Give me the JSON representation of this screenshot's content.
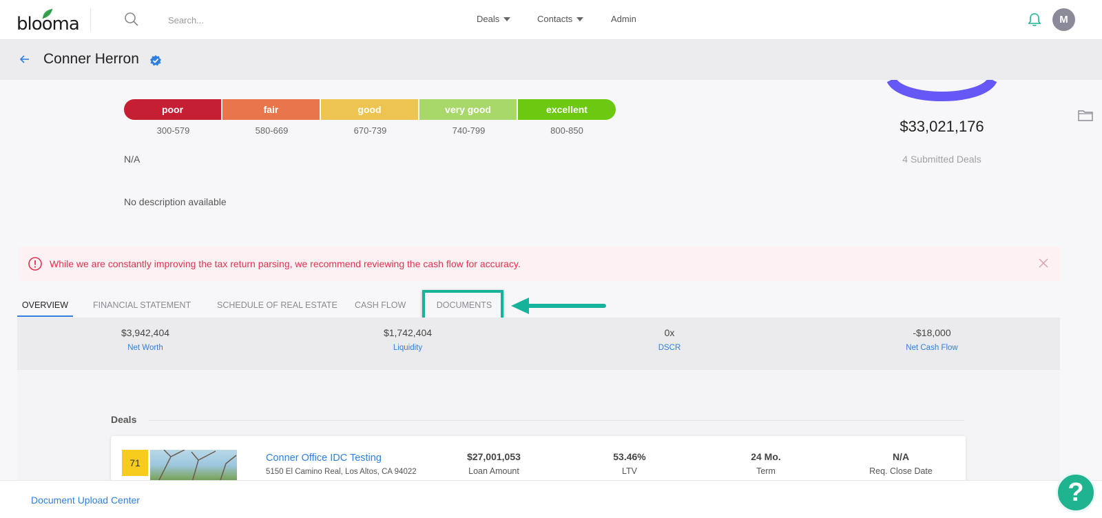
{
  "brand": {
    "name": "blooma",
    "accent": "#2f7fe0",
    "leaf_color": "#3aa655"
  },
  "topnav": {
    "search_placeholder": "Search...",
    "menus": [
      {
        "label": "Deals",
        "has_caret": true
      },
      {
        "label": "Contacts",
        "has_caret": true
      },
      {
        "label": "Admin",
        "has_caret": false
      }
    ],
    "avatar_initial": "M",
    "icons": [
      "search-icon",
      "bell-icon"
    ]
  },
  "header": {
    "title": "Conner Herron",
    "verified": true
  },
  "credit_scale": {
    "segments": [
      {
        "label": "poor",
        "range": "300-579",
        "color": "#c41f32"
      },
      {
        "label": "fair",
        "range": "580-669",
        "color": "#e9764a"
      },
      {
        "label": "good",
        "range": "670-739",
        "color": "#edc452"
      },
      {
        "label": "very good",
        "range": "740-799",
        "color": "#a8d86a"
      },
      {
        "label": "excellent",
        "range": "800-850",
        "color": "#6cc90f"
      }
    ],
    "score_text": "N/A"
  },
  "description": "No description available",
  "summary": {
    "total_amount": "$33,021,176",
    "submitted_deals": "4 Submitted Deals",
    "ring_color": "#6558f5"
  },
  "alert": {
    "text": "While we are constantly improving the tax return parsing, we recommend reviewing the cash flow for accuracy.",
    "color": "#e0334f"
  },
  "tabs": [
    {
      "label": "OVERVIEW",
      "active": true
    },
    {
      "label": "FINANCIAL STATEMENT",
      "active": false
    },
    {
      "label": "SCHEDULE OF REAL ESTATE",
      "active": false
    },
    {
      "label": "CASH FLOW",
      "active": false
    },
    {
      "label": "DOCUMENTS",
      "active": false,
      "highlighted": true
    }
  ],
  "metrics": [
    {
      "value": "$3,942,404",
      "label": "Net Worth"
    },
    {
      "value": "$1,742,404",
      "label": "Liquidity"
    },
    {
      "value": "0x",
      "label": "DSCR"
    },
    {
      "value": "-$18,000",
      "label": "Net Cash Flow"
    }
  ],
  "deals": {
    "title": "Deals",
    "items": [
      {
        "score": "71",
        "name": "Conner Office IDC Testing",
        "address": "5150 El Camino Real, Los Altos, CA 94022",
        "stats": [
          {
            "value": "$27,001,053",
            "label": "Loan Amount"
          },
          {
            "value": "53.46%",
            "label": "LTV"
          },
          {
            "value": "24 Mo.",
            "label": "Term"
          },
          {
            "value": "N/A",
            "label": "Req. Close Date"
          }
        ]
      }
    ]
  },
  "footer": {
    "link": "Document Upload Center"
  },
  "help": {
    "label": "?"
  },
  "callout_color": "#16b39a"
}
